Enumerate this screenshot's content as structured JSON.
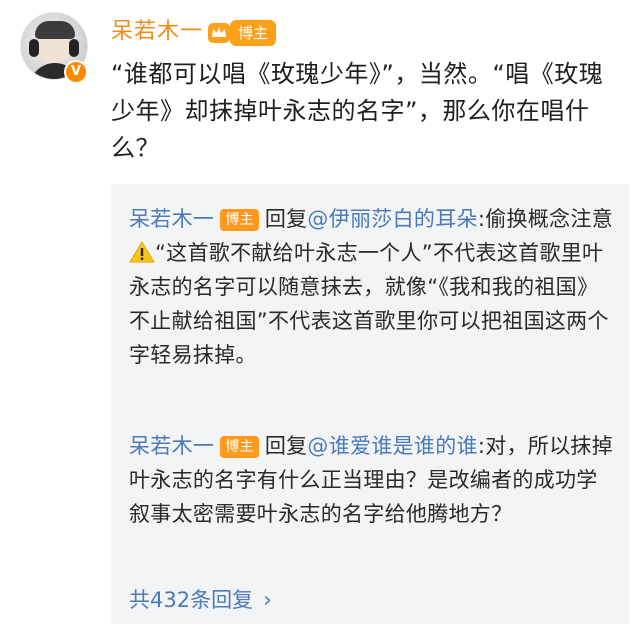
{
  "post": {
    "username": "呆若木一",
    "blogger_badge": "博主",
    "verified_badge": "V",
    "text": "“谁都可以唱《玫瑰少年》”，当然。“唱《玫瑰少年》却抹掉叶永志的名字”，那么你在唱什么？"
  },
  "replies": [
    {
      "author": "呆若木一",
      "badge": "博主",
      "reply_word": "回复",
      "mention": "@伊丽莎白的耳朵",
      "text_before_icon": ":偷换概念注意",
      "icon": "warning-icon",
      "text_after_icon": "“这首歌不献给叶永志一个人”不代表这首歌里叶永志的名字可以随意抹去，就像“《我和我的祖国》不止献给祖国”不代表这首歌里你可以把祖国这两个字轻易抹掉。"
    },
    {
      "author": "呆若木一",
      "badge": "博主",
      "reply_word": "回复",
      "mention": "@谁爱谁是谁的谁",
      "text": ":对，所以抹掉叶永志的名字有什么正当理由？是改编者的成功学叙事太密需要叶永志的名字给他腾地方？"
    }
  ],
  "more_replies": {
    "label": "共432条回复",
    "chevron": "›"
  },
  "colors": {
    "username": "#f08a18",
    "badge": "#ffa01a",
    "link": "#4a7ab8",
    "reply_background": "#f3f4f6",
    "verified": "#ff8a00"
  }
}
